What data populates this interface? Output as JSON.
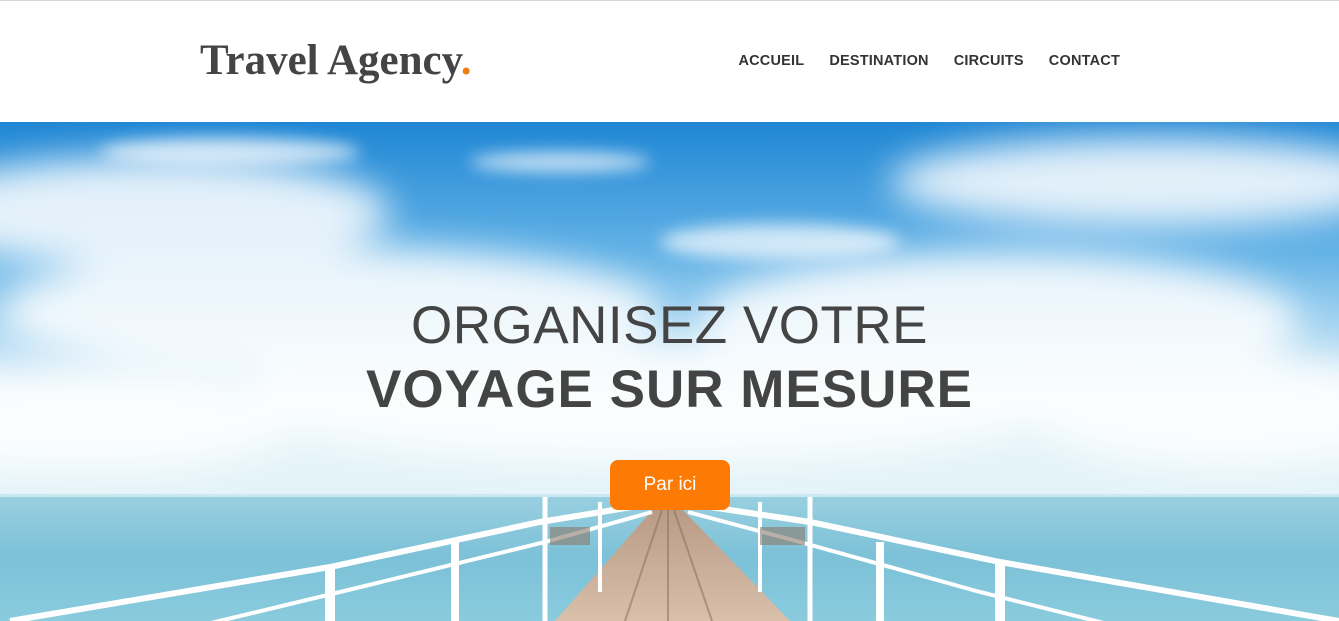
{
  "header": {
    "logo_text": "Travel Agency",
    "logo_dot": ".",
    "nav": [
      {
        "label": "ACCUEIL"
      },
      {
        "label": "DESTINATION"
      },
      {
        "label": "CIRCUITS"
      },
      {
        "label": "CONTACT"
      }
    ]
  },
  "hero": {
    "title_line1": "ORGANISEZ VOTRE",
    "title_line2": "VOYAGE SUR MESURE",
    "cta_label": "Par ici"
  },
  "colors": {
    "accent": "#fd7a04",
    "logo_dot": "#f07d11",
    "text": "#444444"
  }
}
